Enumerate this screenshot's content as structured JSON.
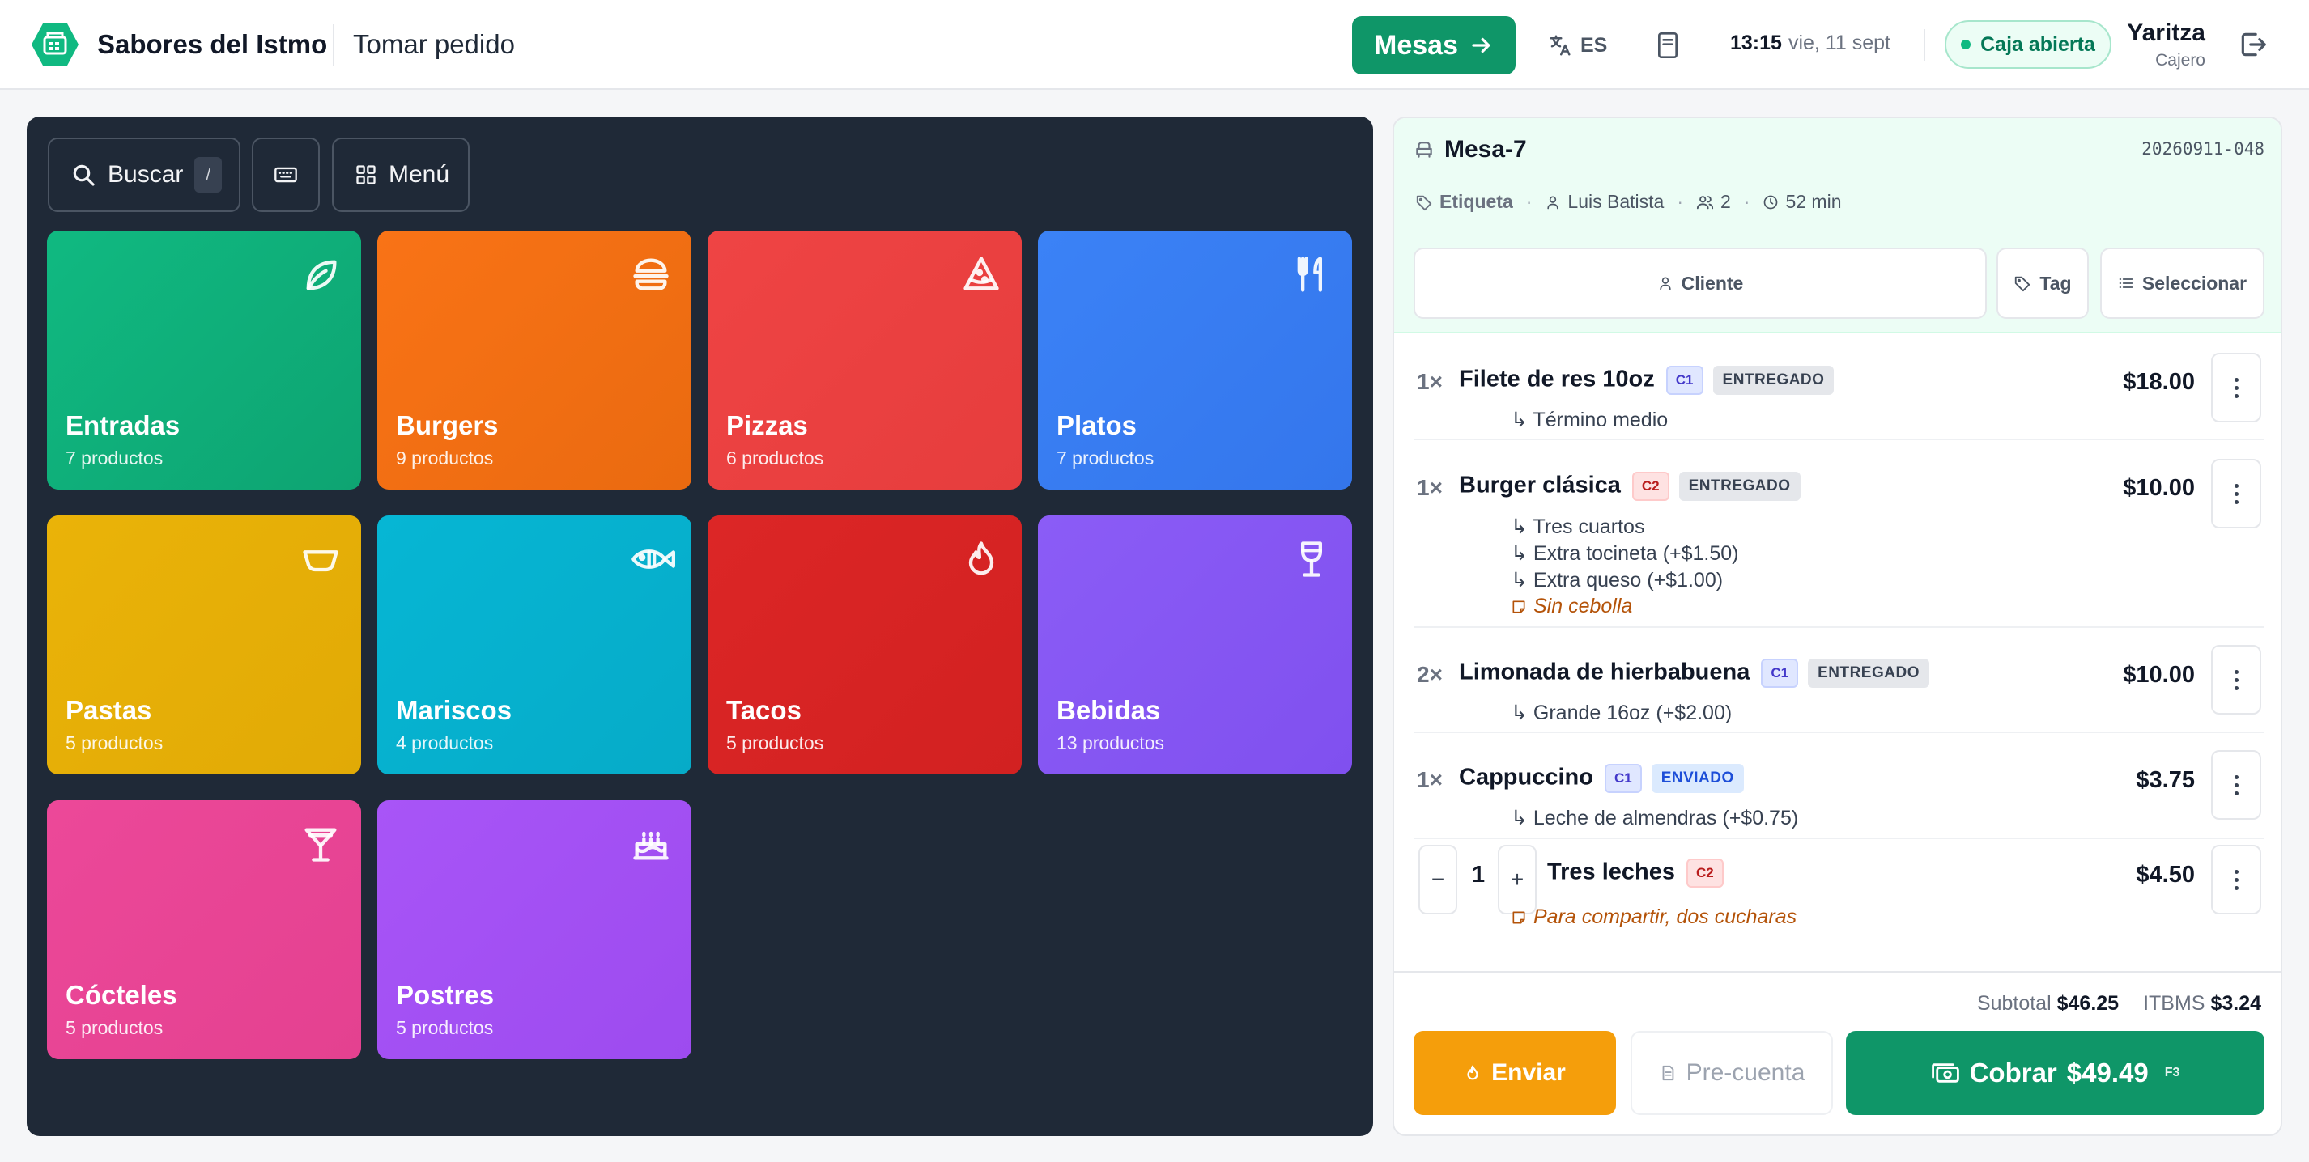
{
  "header": {
    "brand": "Sabores del Istmo",
    "page_title": "Tomar pedido",
    "mesas_label": "Mesas",
    "lang": "ES",
    "time": "13:15",
    "date": "vie, 11 sept",
    "caja_status": "Caja abierta",
    "user_name": "Yaritza",
    "user_role": "Cajero",
    "colors": {
      "brand_green": "#0f9668"
    }
  },
  "toolbar": {
    "search_label": "Buscar",
    "search_shortcut": "/",
    "menu_label": "Menú"
  },
  "categories": [
    {
      "name": "Entradas",
      "count": "7 productos",
      "icon": "leaf-icon",
      "color": "#10b981"
    },
    {
      "name": "Burgers",
      "count": "9 productos",
      "icon": "burger-icon",
      "color": "#f97316"
    },
    {
      "name": "Pizzas",
      "count": "6 productos",
      "icon": "pizza-icon",
      "color": "#ef4444"
    },
    {
      "name": "Platos",
      "count": "7 productos",
      "icon": "utensils-icon",
      "color": "#3b82f6"
    },
    {
      "name": "Pastas",
      "count": "5 productos",
      "icon": "bowl-icon",
      "color": "#eab308"
    },
    {
      "name": "Mariscos",
      "count": "4 productos",
      "icon": "fish-icon",
      "color": "#06b6d4"
    },
    {
      "name": "Tacos",
      "count": "5 productos",
      "icon": "flame-icon",
      "color": "#dc2626"
    },
    {
      "name": "Bebidas",
      "count": "13 productos",
      "icon": "wine-icon",
      "color": "#8b5cf6"
    },
    {
      "name": "Cócteles",
      "count": "5 productos",
      "icon": "martini-icon",
      "color": "#ec4899"
    },
    {
      "name": "Postres",
      "count": "5 productos",
      "icon": "cake-icon",
      "color": "#a855f7"
    }
  ],
  "order": {
    "table": "Mesa-7",
    "number": "20260911-048",
    "tag_label": "Etiqueta",
    "waiter": "Luis Batista",
    "guests": "2",
    "elapsed": "52 min",
    "cliente_label": "Cliente",
    "tag_button": "Tag",
    "select_button": "Seleccionar",
    "items": [
      {
        "qty": "1×",
        "name": "Filete de res 10oz",
        "course": "C1",
        "status": "ENTREGADO",
        "price": "$18.00",
        "mods": [
          "↳ Término medio"
        ]
      },
      {
        "qty": "1×",
        "name": "Burger clásica",
        "course": "C2",
        "status": "ENTREGADO",
        "price": "$10.00",
        "mods": [
          "↳ Tres cuartos",
          "↳ Extra tocineta (+$1.50)",
          "↳ Extra queso (+$1.00)"
        ],
        "note": "Sin cebolla"
      },
      {
        "qty": "2×",
        "name": "Limonada de hierbabuena",
        "course": "C1",
        "status": "ENTREGADO",
        "price": "$10.00",
        "mods": [
          "↳ Grande 16oz (+$2.00)"
        ]
      },
      {
        "qty": "1×",
        "name": "Cappuccino",
        "course": "C1",
        "status": "ENVIADO",
        "price": "$3.75",
        "mods": [
          "↳ Leche de almendras (+$0.75)"
        ]
      },
      {
        "qty": "1",
        "name": "Tres leches",
        "course": "C2",
        "status": "",
        "price": "$4.50",
        "note": "Para compartir, dos cucharas"
      }
    ],
    "subtotal_label": "Subtotal",
    "subtotal": "$46.25",
    "tax_label": "ITBMS",
    "tax": "$3.24",
    "enviar_label": "Enviar",
    "precuenta_label": "Pre-cuenta",
    "cobrar_label": "Cobrar",
    "cobrar_amount": "$49.49",
    "cobrar_shortcut": "F3"
  }
}
